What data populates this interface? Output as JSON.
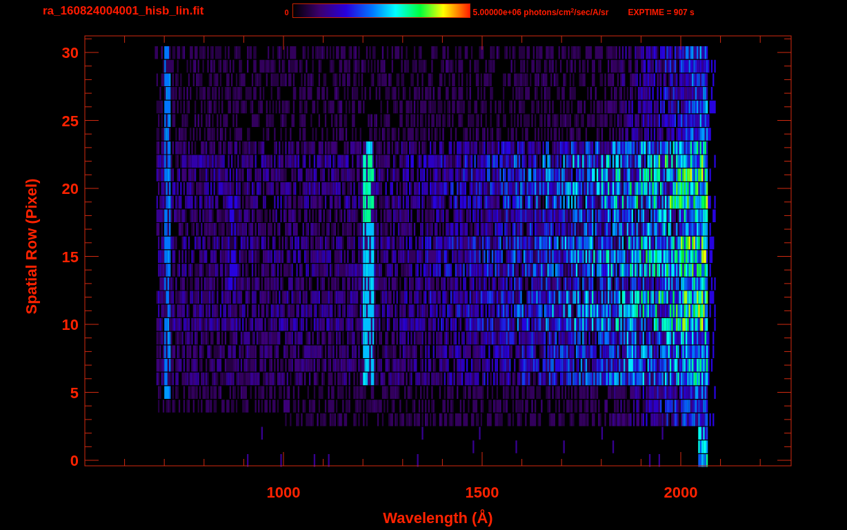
{
  "title": "ra_160824004001_hisb_lin.fit",
  "colorbar": {
    "min_label": "0",
    "max_label": "5.00000e+06 photons/cm$^{2}$/sec/A/sr"
  },
  "exptime": "EXPTIME = 907 s",
  "plot": {
    "xlabel": "Wavelength (Å)",
    "ylabel": "Spatial Row (Pixel)",
    "yticks": [
      "30",
      "25",
      "20",
      "15",
      "10",
      "5",
      "0"
    ],
    "xticks": [
      "1000",
      "1500",
      "2000"
    ]
  }
}
